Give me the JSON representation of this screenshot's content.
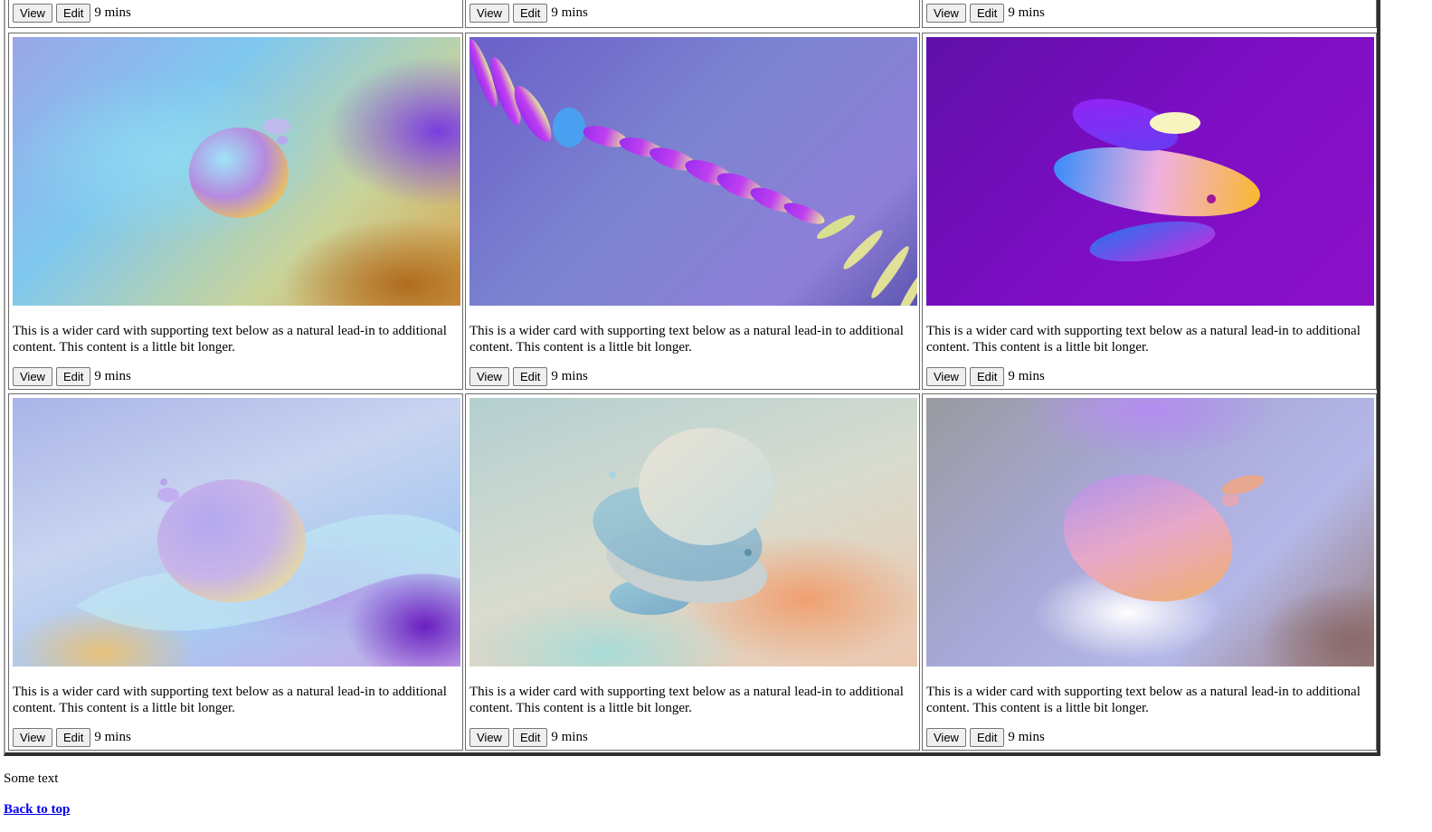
{
  "cards": [
    {
      "view": "View",
      "edit": "Edit",
      "time": "9 mins"
    },
    {
      "view": "View",
      "edit": "Edit",
      "time": "9 mins"
    },
    {
      "view": "View",
      "edit": "Edit",
      "time": "9 mins"
    },
    {
      "text": "This is a wider card with supporting text below as a natural lead-in to additional content. This content is a little bit longer.",
      "view": "View",
      "edit": "Edit",
      "time": "9 mins"
    },
    {
      "text": "This is a wider card with supporting text below as a natural lead-in to additional content. This content is a little bit longer.",
      "view": "View",
      "edit": "Edit",
      "time": "9 mins"
    },
    {
      "text": "This is a wider card with supporting text below as a natural lead-in to additional content. This content is a little bit longer.",
      "view": "View",
      "edit": "Edit",
      "time": "9 mins"
    },
    {
      "text": "This is a wider card with supporting text below as a natural lead-in to additional content. This content is a little bit longer.",
      "view": "View",
      "edit": "Edit",
      "time": "9 mins"
    },
    {
      "text": "This is a wider card with supporting text below as a natural lead-in to additional content. This content is a little bit longer.",
      "view": "View",
      "edit": "Edit",
      "time": "9 mins"
    },
    {
      "text": "This is a wider card with supporting text below as a natural lead-in to additional content. This content is a little bit longer.",
      "view": "View",
      "edit": "Edit",
      "time": "9 mins"
    }
  ],
  "footer": {
    "text": "Some text",
    "back_to_top": "Back to top"
  }
}
